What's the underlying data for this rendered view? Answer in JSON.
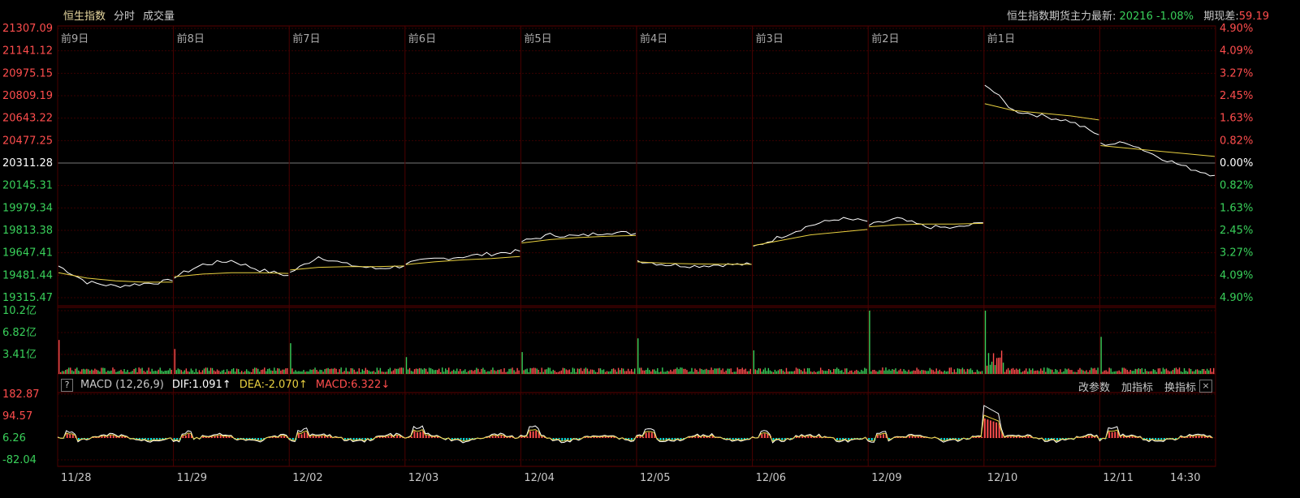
{
  "tabs": [
    {
      "label": "恒生指数",
      "active": true
    },
    {
      "label": "分时",
      "active": false
    },
    {
      "label": "成交量",
      "active": false
    }
  ],
  "futures": {
    "label": "恒生指数期货主力最新:",
    "price": "20216",
    "change": "-1.08%",
    "basis_label": "期现差:",
    "basis_value": "59.19"
  },
  "price_axis_left": [
    "21307.09",
    "21141.12",
    "20975.15",
    "20809.19",
    "20643.22",
    "20477.25",
    "20311.28",
    "20145.31",
    "19979.34",
    "19813.38",
    "19647.41",
    "19481.44",
    "19315.47"
  ],
  "price_axis_right": [
    "4.90%",
    "4.09%",
    "3.27%",
    "2.45%",
    "1.63%",
    "0.82%",
    "0.00%",
    "0.82%",
    "1.63%",
    "2.45%",
    "3.27%",
    "4.09%",
    "4.90%"
  ],
  "day_labels": [
    "前9日",
    "前8日",
    "前7日",
    "前6日",
    "前5日",
    "前4日",
    "前3日",
    "前2日",
    "前1日"
  ],
  "date_labels": [
    "11/28",
    "11/29",
    "12/02",
    "12/03",
    "12/04",
    "12/05",
    "12/06",
    "12/09",
    "12/10",
    "12/11",
    "14:30"
  ],
  "volume_axis": [
    "10.2亿",
    "6.82亿",
    "3.41亿"
  ],
  "macd": {
    "help": "?",
    "name": "MACD (12,26,9)",
    "dif": "DIF:1.091↑",
    "dea": "DEA:-2.070↑",
    "macd": "MACD:6.322↓",
    "actions": [
      "改参数",
      "加指标",
      "换指标"
    ],
    "close": "×",
    "axis": [
      "182.87",
      "94.57",
      "6.26",
      "-82.04"
    ]
  },
  "colors": {
    "up": "#ff4d4d",
    "down": "#39d05a",
    "avg": "#e8d040",
    "price": "#ffffff",
    "grid": "#3a0000",
    "cyan": "#00e0e0"
  },
  "chart_data": {
    "type": "line",
    "title": "",
    "days": [
      "11/28",
      "11/29",
      "12/02",
      "12/03",
      "12/04",
      "12/05",
      "12/06",
      "12/09",
      "12/10",
      "12/11"
    ],
    "ylim": [
      19315.47,
      21307.09
    ],
    "prev_close": 20311.28,
    "series": [
      {
        "values": [
          [
            19550,
            19430,
            19400,
            19420,
            19440
          ],
          [
            19470,
            19560,
            19590,
            19520,
            19480
          ],
          [
            19500,
            19620,
            19560,
            19530,
            19550
          ],
          [
            19570,
            19600,
            19620,
            19640,
            19660
          ],
          [
            19730,
            19780,
            19770,
            19800,
            19790
          ],
          [
            19590,
            19560,
            19550,
            19560,
            19560
          ],
          [
            19690,
            19770,
            19850,
            19900,
            19880
          ],
          [
            19850,
            19900,
            19840,
            19830,
            19870
          ],
          [
            20900,
            20700,
            20660,
            20620,
            20520
          ],
          [
            20450,
            20460,
            20360,
            20280,
            20220
          ]
        ]
      },
      {
        "values": [
          [
            19500,
            19460,
            19440,
            19430,
            19430
          ],
          [
            19470,
            19490,
            19500,
            19500,
            19495
          ],
          [
            19520,
            19540,
            19545,
            19545,
            19550
          ],
          [
            19560,
            19580,
            19595,
            19605,
            19620
          ],
          [
            19720,
            19745,
            19760,
            19770,
            19775
          ],
          [
            19580,
            19570,
            19565,
            19563,
            19562
          ],
          [
            19700,
            19740,
            19780,
            19800,
            19820
          ],
          [
            19840,
            19855,
            19860,
            19860,
            19865
          ],
          [
            20750,
            20700,
            20680,
            20660,
            20630
          ],
          [
            20440,
            20420,
            20400,
            20380,
            20360
          ]
        ]
      }
    ]
  }
}
